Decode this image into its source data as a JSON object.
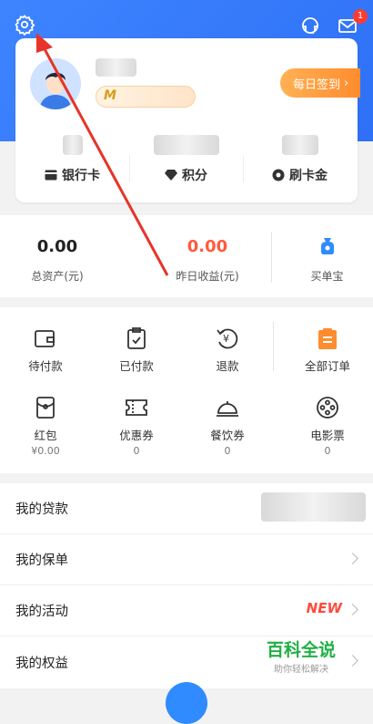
{
  "header": {
    "notification_count": "1"
  },
  "profile": {
    "level_badge": "M",
    "checkin_label": "每日签到"
  },
  "stats": [
    {
      "label": "银行卡",
      "icon": "bank-card-icon"
    },
    {
      "label": "积分",
      "icon": "diamond-icon"
    },
    {
      "label": "刷卡金",
      "icon": "coin-icon"
    }
  ],
  "money": {
    "total_value": "0.00",
    "total_label": "总资产(元)",
    "yesterday_value": "0.00",
    "yesterday_label": "昨日收益(元)",
    "buy_label": "买单宝"
  },
  "orders": {
    "row1": [
      {
        "label": "待付款",
        "icon": "wallet-icon"
      },
      {
        "label": "已付款",
        "icon": "clipboard-check-icon"
      },
      {
        "label": "退款",
        "icon": "refund-icon"
      },
      {
        "label": "全部订单",
        "icon": "orders-icon"
      }
    ],
    "row2": [
      {
        "label": "红包",
        "sub": "¥0.00",
        "icon": "red-packet-icon"
      },
      {
        "label": "优惠券",
        "sub": "0",
        "icon": "coupon-icon"
      },
      {
        "label": "餐饮券",
        "sub": "0",
        "icon": "dining-icon"
      },
      {
        "label": "电影票",
        "sub": "0",
        "icon": "film-icon"
      }
    ]
  },
  "menu": [
    {
      "label": "我的贷款"
    },
    {
      "label": "我的保单"
    },
    {
      "label": "我的活动",
      "tag": "NEW"
    },
    {
      "label": "我的权益"
    }
  ],
  "watermark": {
    "title": "百科全说",
    "subtitle": "助你轻松解决"
  },
  "colors": {
    "primary": "#2c6df5",
    "accent_orange": "#ff8c2e",
    "profit_red": "#ff5a3c"
  }
}
